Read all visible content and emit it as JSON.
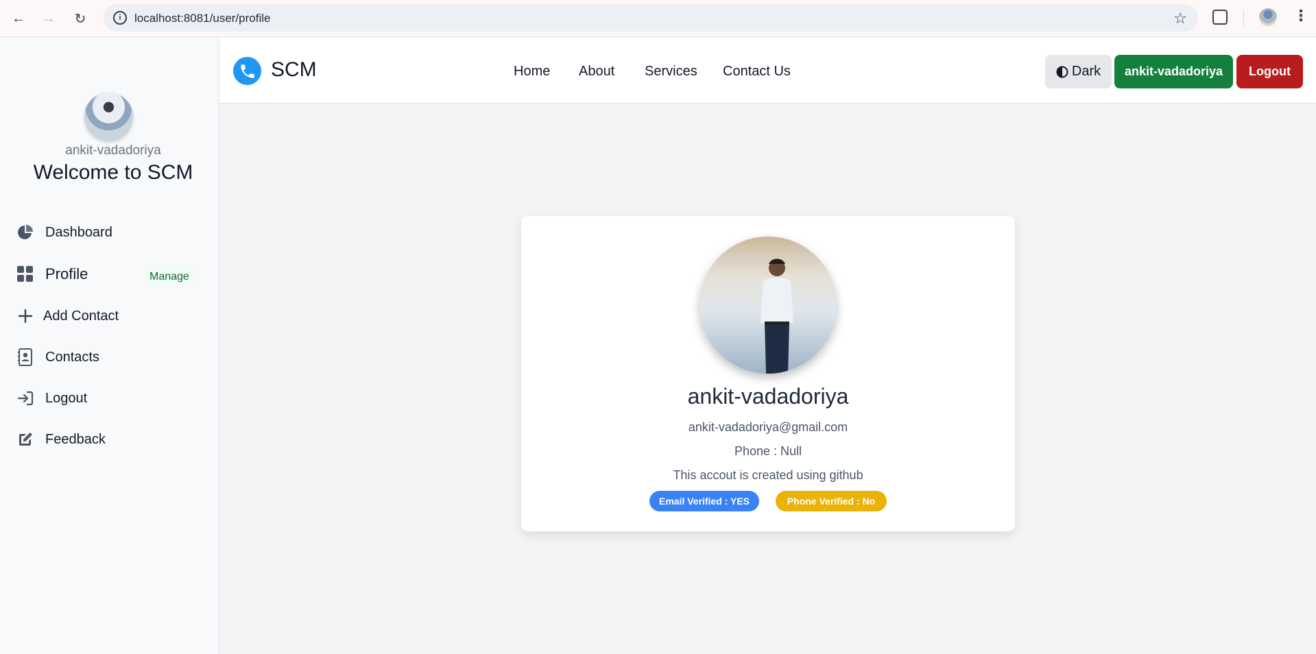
{
  "browser": {
    "url": "localhost:8081/user/profile",
    "icons": [
      "back-icon",
      "forward-icon",
      "reload-icon",
      "info-icon",
      "star-icon",
      "extensions-icon",
      "menu-icon"
    ]
  },
  "sidebar": {
    "username": "ankit-vadadoriya",
    "welcome": "Welcome to SCM",
    "items": [
      {
        "label": "Dashboard",
        "icon": "chart-pie-icon"
      },
      {
        "label": "Profile",
        "icon": "grid-icon",
        "badge": "Manage"
      },
      {
        "label": "Add Contact",
        "icon": "plus-icon"
      },
      {
        "label": "Contacts",
        "icon": "address-book-icon"
      },
      {
        "label": "Logout",
        "icon": "sign-in-icon"
      },
      {
        "label": "Feedback",
        "icon": "edit-icon"
      }
    ]
  },
  "navbar": {
    "brand": "SCM",
    "brand_icon": "phone-icon",
    "links": [
      "Home",
      "About",
      "Services",
      "Contact Us"
    ],
    "theme_label": "Dark",
    "user_button": "ankit-vadadoriya",
    "logout_button": "Logout"
  },
  "profile": {
    "name": "ankit-vadadoriya",
    "email": "ankit-vadadoriya@gmail.com",
    "phone": "Phone : Null",
    "about": "This accout is created using github",
    "email_badge": "Email Verified : YES",
    "phone_badge": "Phone Verified : No"
  },
  "colors": {
    "brand_blue": "#2196f3",
    "user_button": "#15803d",
    "logout_button": "#b91c1c",
    "email_badge": "#3b82f6",
    "phone_badge": "#eab308"
  }
}
